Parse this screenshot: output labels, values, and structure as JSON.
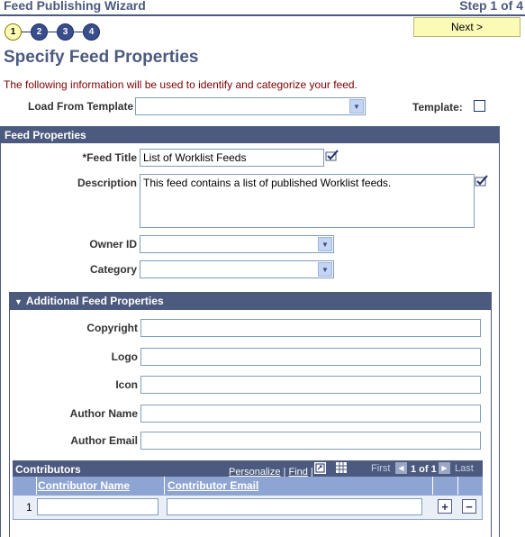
{
  "wizard": {
    "title": "Feed Publishing Wizard",
    "step_label": "Step 1 of 4",
    "steps": [
      "1",
      "2",
      "3",
      "4"
    ],
    "next_label": "Next >"
  },
  "page": {
    "title": "Specify Feed Properties",
    "intro": "The following information will be used to identify and categorize your feed."
  },
  "template": {
    "load_label": "Load From Template",
    "load_value": "",
    "template_label": "Template:",
    "template_checked": false
  },
  "feed_properties": {
    "header": "Feed Properties",
    "feed_title_label": "*Feed Title",
    "feed_title_value": "List of Worklist Feeds",
    "description_label": "Description",
    "description_value": "This feed contains a list of published Worklist feeds.",
    "owner_id_label": "Owner ID",
    "owner_id_value": "",
    "category_label": "Category",
    "category_value": ""
  },
  "additional": {
    "header": "Additional Feed Properties",
    "copyright_label": "Copyright",
    "copyright_value": "",
    "logo_label": "Logo",
    "logo_value": "",
    "icon_label": "Icon",
    "icon_value": "",
    "author_name_label": "Author Name",
    "author_name_value": "",
    "author_email_label": "Author Email",
    "author_email_value": ""
  },
  "contributors": {
    "header": "Contributors",
    "personalize": "Personalize",
    "find": "Find",
    "first": "First",
    "range": "1 of 1",
    "last": "Last",
    "columns": [
      "Contributor Name",
      "Contributor Email"
    ],
    "rows": [
      {
        "num": "1",
        "name": "",
        "email": ""
      }
    ]
  },
  "colors": {
    "header_bg": "#4b5a7e",
    "title": "#4b5a7e",
    "intro": "#7a0000",
    "next_bg": "#fbfbb6"
  },
  "icons": [
    "spellcheck-icon",
    "dropdown-arrow-icon",
    "expand-triangle-icon",
    "zoom-icon",
    "grid-download-icon",
    "prev-arrow-icon",
    "next-arrow-icon",
    "add-row-icon",
    "delete-row-icon"
  ]
}
